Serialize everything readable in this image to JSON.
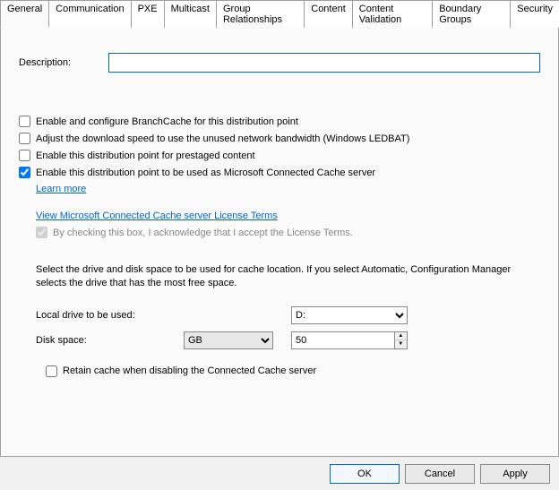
{
  "tabs": {
    "general": "General",
    "communication": "Communication",
    "pxe": "PXE",
    "multicast": "Multicast",
    "group_relationships": "Group Relationships",
    "content": "Content",
    "content_validation": "Content Validation",
    "boundary_groups": "Boundary Groups",
    "security": "Security"
  },
  "description_label": "Description:",
  "description_value": "",
  "checkboxes": {
    "branchcache": "Enable and configure BranchCache for this distribution point",
    "ledbat": "Adjust the download speed to use the unused network bandwidth (Windows LEDBAT)",
    "prestaged": "Enable this distribution point for prestaged content",
    "connected_cache": "Enable this distribution point to be used as Microsoft Connected Cache server"
  },
  "learn_more": "Learn more",
  "license_link": "View Microsoft Connected Cache server License Terms",
  "license_ack": "By checking this box, I acknowledge that I accept the License Terms.",
  "cache_location_text": "Select the drive and disk space to be used for cache location. If you select Automatic, Configuration Manager selects the drive that has the most free space.",
  "local_drive_label": "Local drive to be used:",
  "local_drive_value": "D:",
  "disk_space_label": "Disk space:",
  "disk_space_unit": "GB",
  "disk_space_value": "50",
  "retain_cache": "Retain cache when disabling the Connected Cache server",
  "buttons": {
    "ok": "OK",
    "cancel": "Cancel",
    "apply": "Apply"
  }
}
